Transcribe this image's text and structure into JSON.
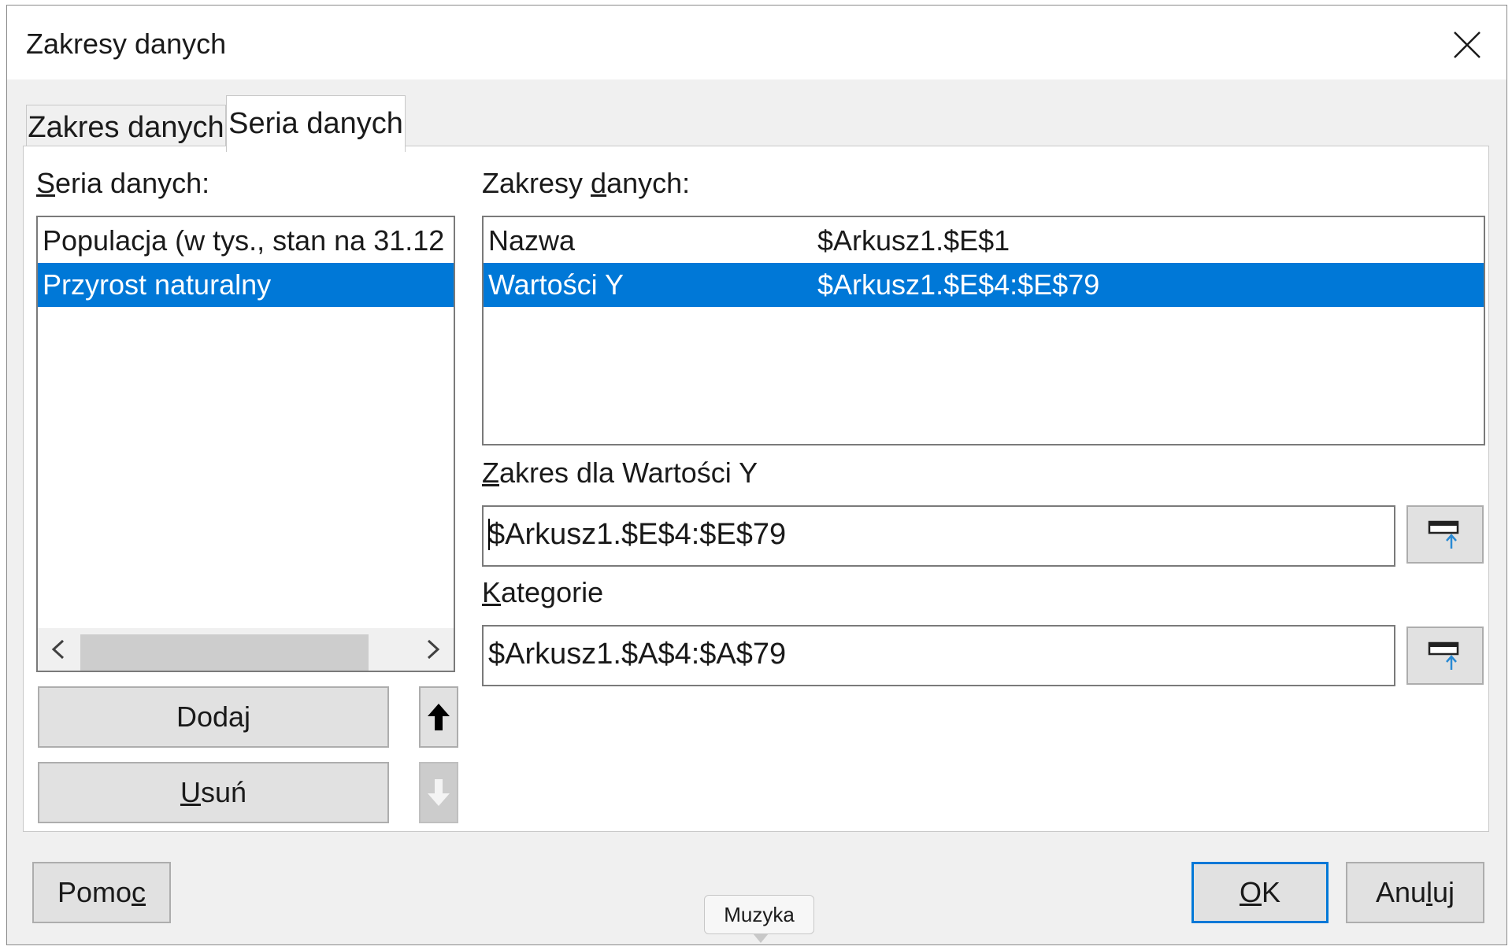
{
  "window": {
    "title": "Zakresy danych"
  },
  "tabs": [
    {
      "label": "Zakres danych",
      "active": false
    },
    {
      "label": "Seria danych",
      "active": true
    }
  ],
  "series_panel": {
    "label": "Seria danych:",
    "items": [
      {
        "label": "Populacja (w tys., stan na 31.12",
        "selected": false
      },
      {
        "label": "Przyrost naturalny",
        "selected": true
      }
    ],
    "add_label": "Dodaj",
    "remove_label": "Usuń"
  },
  "ranges_panel": {
    "label": "Zakresy danych:",
    "rows": [
      {
        "name": "Nazwa",
        "range": "$Arkusz1.$E$1",
        "selected": false
      },
      {
        "name": "Wartości Y",
        "range": "$Arkusz1.$E$4:$E$79",
        "selected": true
      }
    ]
  },
  "y_range": {
    "label": "Zakres dla Wartości Y",
    "value": "$Arkusz1.$E$4:$E$79"
  },
  "categories": {
    "label": "Kategorie",
    "value": "$Arkusz1.$A$4:$A$79"
  },
  "footer": {
    "help_label": "Pomoc",
    "ok_label": "OK",
    "cancel_label": "Anuluj"
  },
  "tooltip": {
    "text": "Muzyka"
  },
  "colors": {
    "selection": "#0078d7",
    "dialog_bg": "#f0f0f0",
    "shrink_arrow": "#2a8ad4"
  }
}
